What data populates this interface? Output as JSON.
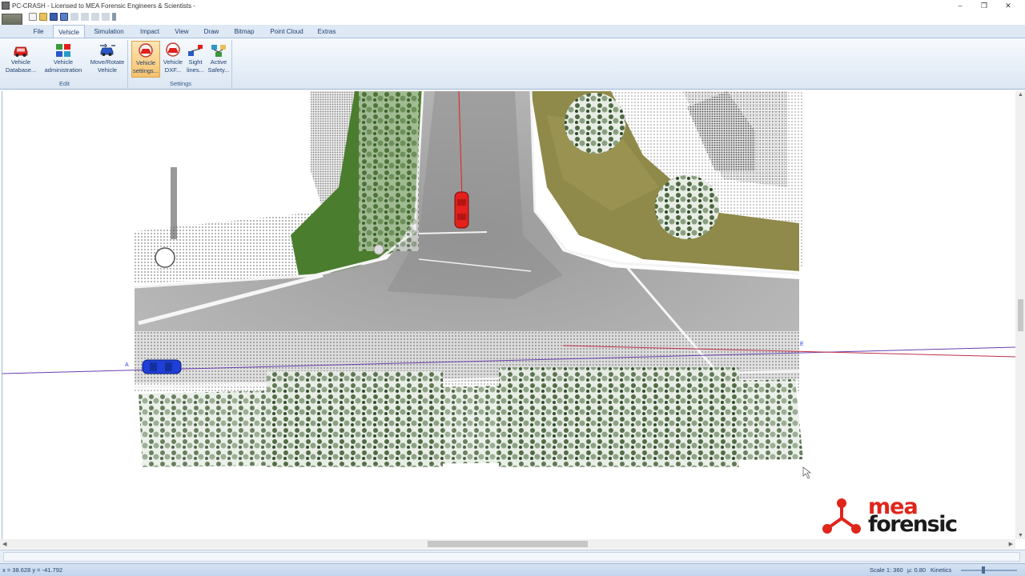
{
  "window": {
    "title": "PC-CRASH - Licensed to MEA Forensic Engineers & Scientists -",
    "minimize": "–",
    "maximize": "❐",
    "close": "✕"
  },
  "ribbon": {
    "tabs": [
      "File",
      "Vehicle",
      "Simulation",
      "Impact",
      "View",
      "Draw",
      "Bitmap",
      "Point Cloud",
      "Extras"
    ],
    "active_tab": "Vehicle",
    "groups": {
      "edit": {
        "label": "Edit",
        "buttons": [
          "Vehicle\nDatabase...",
          "Vehicle\nadministration",
          "Move/Rotate\nVehicle"
        ]
      },
      "settings": {
        "label": "Settings",
        "buttons": [
          "Vehicle\nsettings...",
          "Vehicle\nDXF...",
          "Sight\nlines...",
          "Active\nSafety..."
        ]
      }
    }
  },
  "canvas": {
    "marker_a": "A",
    "marker_e": "E",
    "vehicle_colors": {
      "red": "#e3201b",
      "blue": "#1f3fd8"
    }
  },
  "brand": {
    "line1": "mea",
    "line2": "forensic",
    "color": "#e0251b"
  },
  "status": {
    "coords": "x = 38.628 y = -41.792",
    "scale": "Scale 1: 360",
    "mu": "μ: 0.80",
    "mode": "Kinetics"
  }
}
